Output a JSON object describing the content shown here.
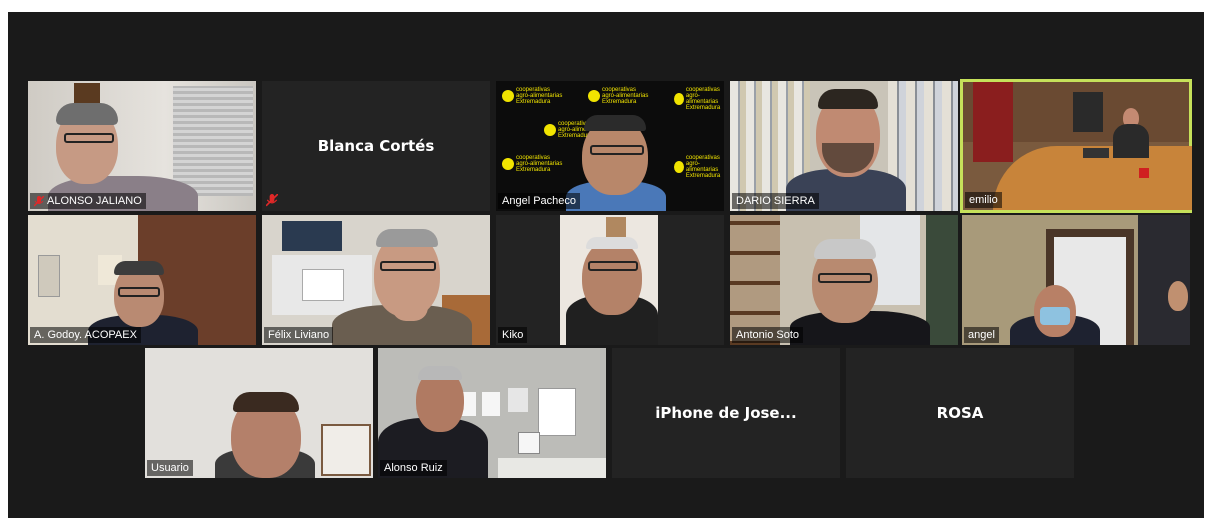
{
  "participants": [
    {
      "name": "ALONSO JALIANO",
      "muted": true
    },
    {
      "name": "Blanca Cortés",
      "muted": true,
      "video": false
    },
    {
      "name": "Angel Pacheco",
      "muted": false
    },
    {
      "name": "DARIO SIERRA",
      "muted": false
    },
    {
      "name": "emilio",
      "muted": false,
      "active_speaker": true
    },
    {
      "name": "A. Godoy. ACOPAEX",
      "muted": false
    },
    {
      "name": "Félix Liviano",
      "muted": false
    },
    {
      "name": "Kiko",
      "muted": false
    },
    {
      "name": "Antonio Soto",
      "muted": false
    },
    {
      "name": "angel",
      "muted": false
    },
    {
      "name": "Usuario",
      "muted": false
    },
    {
      "name": "Alonso Ruiz",
      "muted": false
    },
    {
      "name": "iPhone de Jose...",
      "muted": false,
      "video": false
    },
    {
      "name": "ROSA",
      "muted": false,
      "video": false
    }
  ],
  "background_logo": {
    "line1": "cooperativas",
    "line2": "agro-alimentarias",
    "line3": "Extremadura"
  },
  "colors": {
    "active_speaker_border": "#c6e15a",
    "muted_icon": "#e02828",
    "logo_yellow": "#f1e400"
  }
}
